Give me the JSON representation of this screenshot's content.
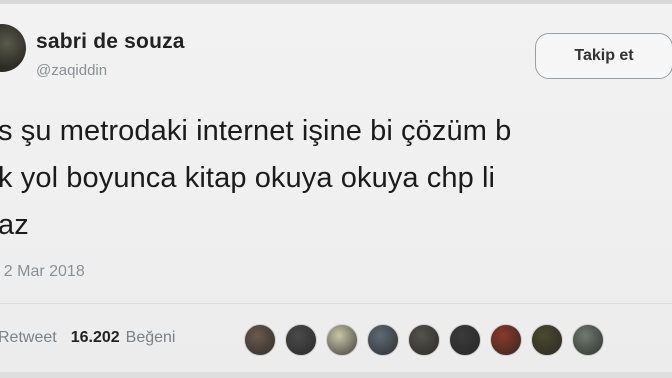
{
  "user": {
    "name": "sabri de souza",
    "handle": "@zaqiddin"
  },
  "follow_button": {
    "label": "Takip et"
  },
  "tweet": {
    "lines": [
      "s şu metrodaki internet işine bi çözüm b",
      "k yol boyunca kitap okuya okuya chp li",
      "az"
    ],
    "date": "- 2 Mar 2018"
  },
  "stats": {
    "retweet_label": "Retweet",
    "likes_count": "16.202",
    "likes_label": "Beğeni"
  },
  "likers": {
    "colors": [
      "#6b5a4e",
      "#4a4a4a",
      "#c9c6a8",
      "#5f6a75",
      "#55534a",
      "#3b3b3b",
      "#8a3a2a",
      "#4b4a2f",
      "#6e7b6f"
    ]
  }
}
